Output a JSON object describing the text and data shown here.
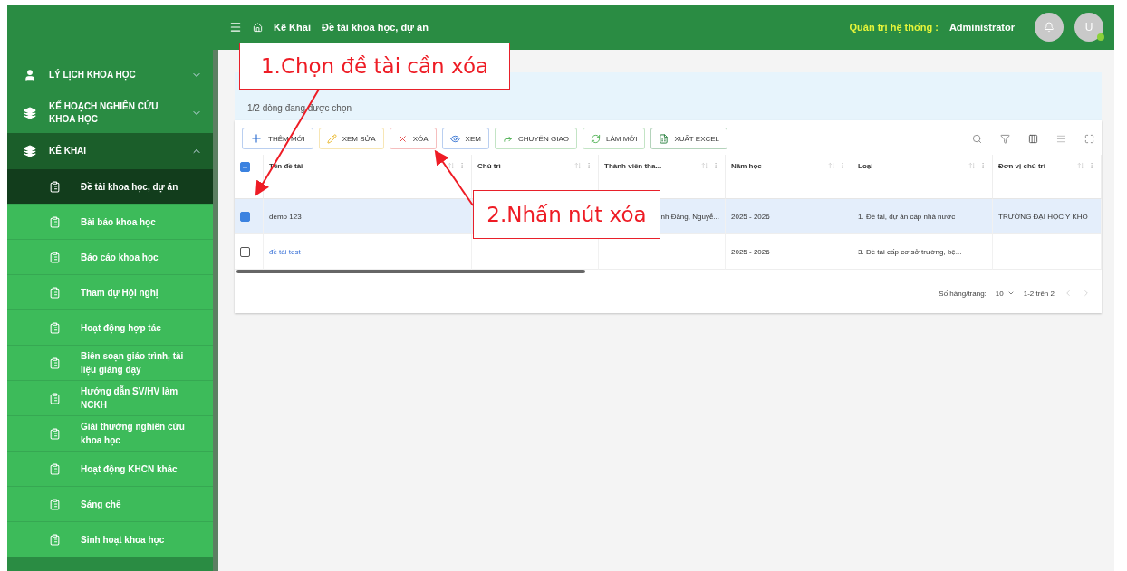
{
  "header": {
    "breadcrumb": [
      "Kê Khai",
      "Đề tài khoa học, dự án"
    ],
    "role_label": "Quản trị hệ thống :",
    "user": "Administrator",
    "avatar_letter": "U"
  },
  "sidebar": {
    "groups": [
      {
        "label": "LÝ LỊCH KHOA HỌC",
        "expanded": false
      },
      {
        "label": "KẾ HOẠCH NGHIÊN CỨU KHOA HỌC",
        "expanded": false
      },
      {
        "label": "KÊ KHAI",
        "expanded": true,
        "children": [
          {
            "label": "Đề tài khoa học, dự án",
            "selected": true
          },
          {
            "label": "Bài báo khoa học",
            "selected": false
          },
          {
            "label": "Báo cáo khoa học",
            "selected": false
          },
          {
            "label": "Tham dự Hội nghị",
            "selected": false
          },
          {
            "label": "Hoạt động hợp tác",
            "selected": false
          },
          {
            "label": "Biên soạn giáo trình, tài liệu giảng dạy",
            "selected": false
          },
          {
            "label": "Hướng dẫn SV/HV làm NCKH",
            "selected": false
          },
          {
            "label": "Giải thưởng nghiên cứu khoa học",
            "selected": false
          },
          {
            "label": "Hoạt động KHCN khác",
            "selected": false
          },
          {
            "label": "Sáng chế",
            "selected": false
          },
          {
            "label": "Sinh hoạt khoa học",
            "selected": false
          }
        ]
      }
    ]
  },
  "selection_banner": "1/2 dòng đang được chọn",
  "toolbar": [
    "THÊM MỚI",
    "XEM SỬA",
    "XÓA",
    "XEM",
    "CHUYỂN GIAO",
    "LÀM MỚI",
    "XUẤT EXCEL"
  ],
  "table": {
    "indeterminate": true,
    "columns": [
      "Tên đề tài",
      "Chủ trì",
      "Thành viên tha...",
      "Năm học",
      "Loại",
      "Đơn vị chủ trì"
    ],
    "rows": [
      {
        "selected": true,
        "cells": [
          "demo 123",
          "",
          "nh Đăng, Nguyễ...",
          "2025 - 2026",
          "1. Đề tài, dự án cấp nhà nước",
          "TRƯỜNG ĐẠI HỌC Y KHO"
        ]
      },
      {
        "selected": false,
        "cells": [
          "đề tài test",
          "",
          "",
          "2025 - 2026",
          "3. Đề tài cấp cơ sở trường, bệ...",
          ""
        ]
      }
    ]
  },
  "pagination": {
    "rows_label": "Số hàng/trang:",
    "rows_per_page": "10",
    "range": "1-2 trên 2"
  },
  "annotations": [
    "1.Chọn đề tài cần xóa",
    "2.Nhấn nút xóa"
  ]
}
